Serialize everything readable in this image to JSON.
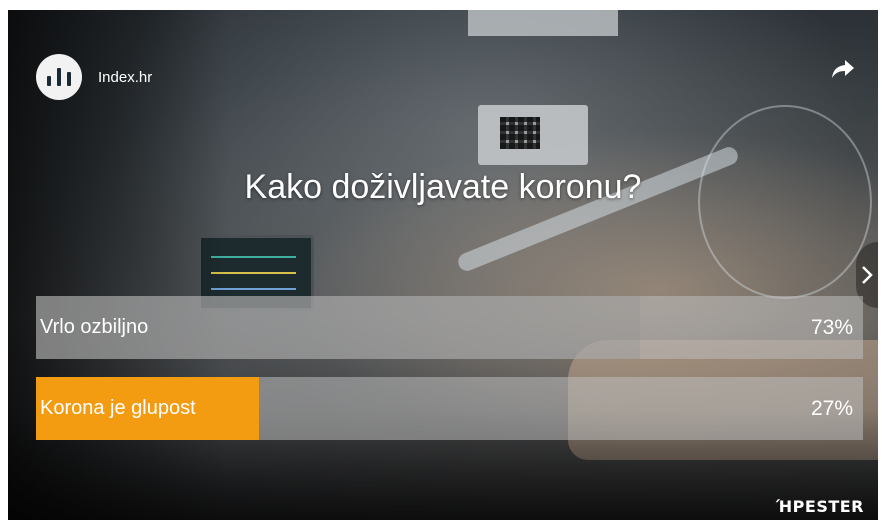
{
  "poll": {
    "publisher": "Index.hr",
    "question": "Kako doživljavate koronu?",
    "options": [
      {
        "label": "Vrlo ozbiljno",
        "percent": "73%",
        "value": 73,
        "color": "#c8c8c8"
      },
      {
        "label": "Korona je glupost",
        "percent": "27%",
        "value": 27,
        "color": "#f39c12"
      }
    ]
  },
  "icons": {
    "share": "share-arrow-icon",
    "next": "chevron-right-icon",
    "avatar": "bar-chart-icon"
  },
  "branding": {
    "logo": "ΉPESTER"
  },
  "colors": {
    "accent": "#f39c12",
    "text": "#ffffff"
  }
}
